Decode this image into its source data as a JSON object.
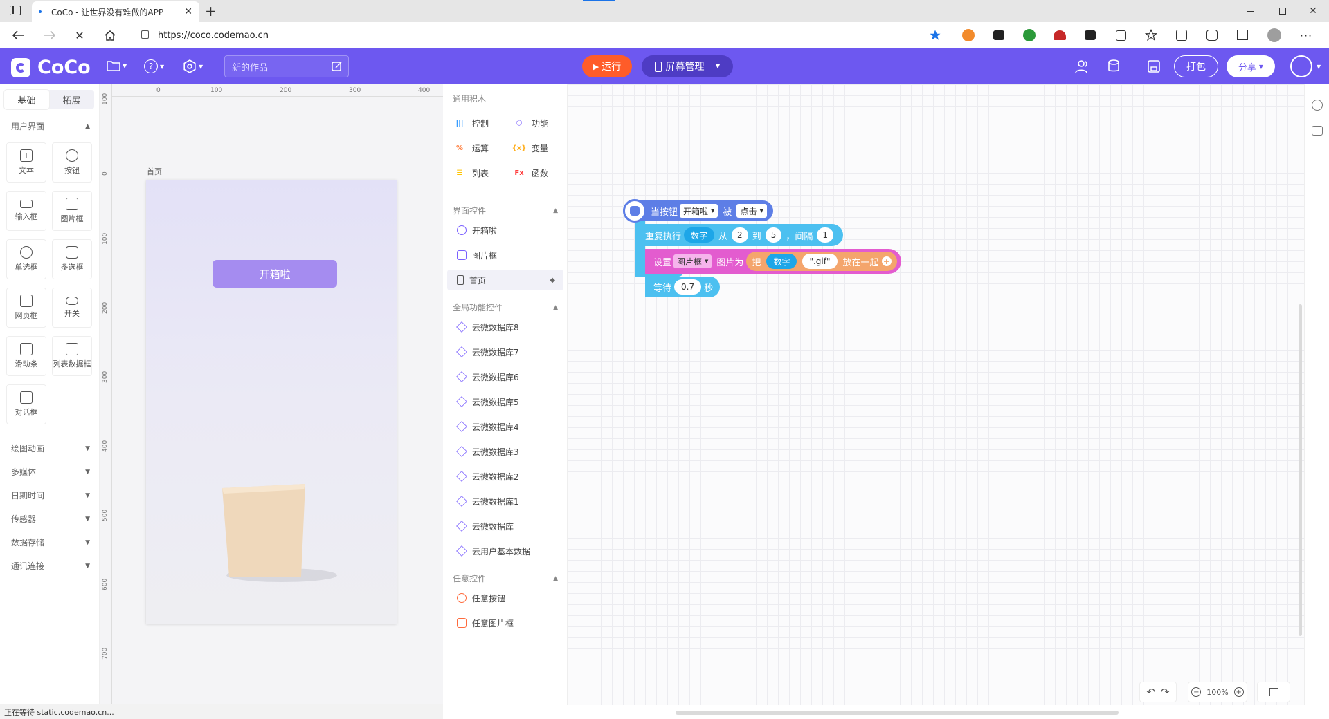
{
  "browser": {
    "tab_title": "CoCo - 让世界没有难做的APP",
    "url": "https://coco.codemao.cn"
  },
  "app": {
    "logo_text": "CoCo",
    "project_name": "新的作品",
    "run_label": "运行",
    "screen_label": "屏幕管理",
    "pack_label": "打包",
    "share_label": "分享",
    "accent": "#6d58f0",
    "run_color": "#ff5c29"
  },
  "palette": {
    "tabs": [
      "基础",
      "拓展"
    ],
    "section_ui": "用户界面",
    "widgets": [
      "文本",
      "按钮",
      "输入框",
      "图片框",
      "单选框",
      "多选框",
      "网页框",
      "开关",
      "滑动条",
      "列表数据框",
      "对话框"
    ],
    "sections": [
      "绘图动画",
      "多媒体",
      "日期时间",
      "传感器",
      "数据存储",
      "通讯连接"
    ]
  },
  "stage": {
    "h_ticks": [
      "0",
      "100",
      "200",
      "300",
      "400"
    ],
    "v_ticks": [
      "100",
      "0",
      "100",
      "200",
      "300",
      "400",
      "500",
      "600",
      "700"
    ],
    "page_label": "首页",
    "button_text": "开箱啦"
  },
  "blocks_panel": {
    "title": "通用积木",
    "categories": [
      {
        "label": "控制",
        "icon": "sliders-icon",
        "color": "#1e90ff"
      },
      {
        "label": "功能",
        "icon": "hexagon-icon",
        "color": "#7b61ff"
      },
      {
        "label": "运算",
        "icon": "percent-icon",
        "color": "#ff7f3f"
      },
      {
        "label": "变量",
        "icon": "braces-icon",
        "color": "#ffb020"
      },
      {
        "label": "列表",
        "icon": "list-icon",
        "color": "#ffc400"
      },
      {
        "label": "函数",
        "icon": "fx-icon",
        "color": "#ff3b3b"
      }
    ],
    "sec_ui": "界面控件",
    "ui_items": [
      "开箱啦",
      "图片框",
      "首页"
    ],
    "sec_global": "全局功能控件",
    "global_items": [
      "云微数据库8",
      "云微数据库7",
      "云微数据库6",
      "云微数据库5",
      "云微数据库4",
      "云微数据库3",
      "云微数据库2",
      "云微数据库1",
      "云微数据库",
      "云用户基本数据"
    ],
    "sec_any": "任意控件",
    "any_items": [
      "任意按钮",
      "任意图片框"
    ]
  },
  "script": {
    "event_prefix": "当按钮",
    "event_target": "开箱啦",
    "event_mid": "被",
    "event_action": "点击",
    "repeat_label": "重复执行",
    "repeat_var": "数字",
    "from_label": "从",
    "from_value": "2",
    "to_label": "到",
    "to_value": "5",
    "step_label": "，间隔",
    "step_value": "1",
    "set_label": "设置",
    "set_target": "图片框",
    "set_prop": "图片为",
    "join_label": "把",
    "join_var": "数字",
    "join_str": "\".gif\"",
    "join_end": "放在一起",
    "wait_label": "等待",
    "wait_value": "0.7",
    "wait_unit": "秒"
  },
  "controls": {
    "zoom": "100%"
  },
  "status": {
    "text": "正在等待 static.codemao.cn..."
  }
}
